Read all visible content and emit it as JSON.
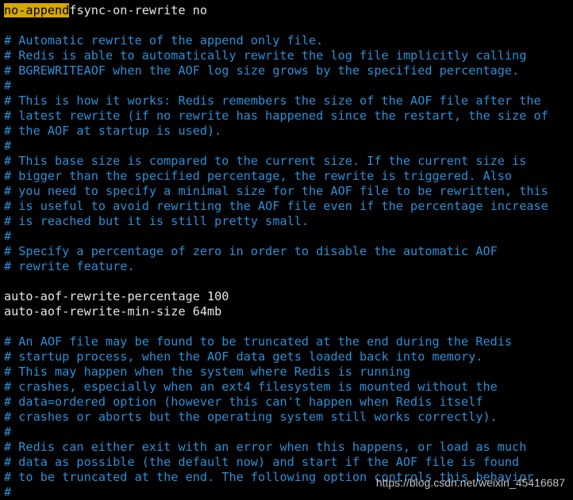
{
  "terminal": {
    "first_line": {
      "highlight": "no-append",
      "rest": "fsync-on-rewrite no"
    },
    "lines": [
      {
        "type": "blank",
        "text": ""
      },
      {
        "type": "comment",
        "text": "# Automatic rewrite of the append only file."
      },
      {
        "type": "comment",
        "text": "# Redis is able to automatically rewrite the log file implicitly calling"
      },
      {
        "type": "comment",
        "text": "# BGREWRITEAOF when the AOF log size grows by the specified percentage."
      },
      {
        "type": "comment",
        "text": "#"
      },
      {
        "type": "comment",
        "text": "# This is how it works: Redis remembers the size of the AOF file after the"
      },
      {
        "type": "comment",
        "text": "# latest rewrite (if no rewrite has happened since the restart, the size of"
      },
      {
        "type": "comment",
        "text": "# the AOF at startup is used)."
      },
      {
        "type": "comment",
        "text": "#"
      },
      {
        "type": "comment",
        "text": "# This base size is compared to the current size. If the current size is"
      },
      {
        "type": "comment",
        "text": "# bigger than the specified percentage, the rewrite is triggered. Also"
      },
      {
        "type": "comment",
        "text": "# you need to specify a minimal size for the AOF file to be rewritten, this"
      },
      {
        "type": "comment",
        "text": "# is useful to avoid rewriting the AOF file even if the percentage increase"
      },
      {
        "type": "comment",
        "text": "# is reached but it is still pretty small."
      },
      {
        "type": "comment",
        "text": "#"
      },
      {
        "type": "comment",
        "text": "# Specify a percentage of zero in order to disable the automatic AOF"
      },
      {
        "type": "comment",
        "text": "# rewrite feature."
      },
      {
        "type": "blank",
        "text": ""
      },
      {
        "type": "config",
        "text": "auto-aof-rewrite-percentage 100"
      },
      {
        "type": "config",
        "text": "auto-aof-rewrite-min-size 64mb"
      },
      {
        "type": "blank",
        "text": ""
      },
      {
        "type": "comment",
        "text": "# An AOF file may be found to be truncated at the end during the Redis"
      },
      {
        "type": "comment",
        "text": "# startup process, when the AOF data gets loaded back into memory."
      },
      {
        "type": "comment",
        "text": "# This may happen when the system where Redis is running"
      },
      {
        "type": "comment",
        "text": "# crashes, especially when an ext4 filesystem is mounted without the"
      },
      {
        "type": "comment",
        "text": "# data=ordered option (however this can't happen when Redis itself"
      },
      {
        "type": "comment",
        "text": "# crashes or aborts but the operating system still works correctly)."
      },
      {
        "type": "comment",
        "text": "#"
      },
      {
        "type": "comment",
        "text": "# Redis can either exit with an error when this happens, or load as much"
      },
      {
        "type": "comment",
        "text": "# data as possible (the default now) and start if the AOF file is found"
      },
      {
        "type": "comment",
        "text": "# to be truncated at the end. The following option controls this behavior."
      },
      {
        "type": "comment",
        "text": "#"
      }
    ]
  },
  "watermark": "https://blog.csdn.net/weixin_45416687",
  "colors": {
    "background": "#000000",
    "comment": "#2b8fd6",
    "config": "#e6e6e6",
    "search_highlight": "#d7a800"
  }
}
